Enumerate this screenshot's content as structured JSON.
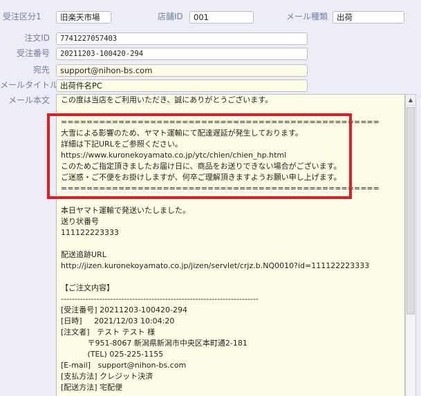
{
  "header": {
    "order_category_label": "受注区分1",
    "order_category_value": "旧楽天市場",
    "shop_id_label": "店舗ID",
    "shop_id_value": "001",
    "mail_type_label": "メール種類",
    "mail_type_value": "出荷"
  },
  "form": {
    "order_id_label": "注文ID",
    "order_id_value": "7741227057403",
    "order_number_label": "受注番号",
    "order_number_value": "20211203-100420-294",
    "recipient_label": "宛先",
    "recipient_value": "support@nihon-bs.com",
    "mail_title_label": "メールタイトル",
    "mail_title_value": "出荷件名PC",
    "mail_body_label": "メール本文"
  },
  "mail_body": {
    "lines": [
      "この度は当店をご利用いただき、誠にありがとうございます。",
      "",
      "==================================================",
      "大雪による影響のため、ヤマト運輸にて配達遅延が発生しております。",
      "詳細は下記URLをご参照ください。",
      "https://www.kuronekoyamato.co.jp/ytc/chien/chien_hp.html",
      "このためご指定頂きましたお届け日に、商品をお送りできない場合がございます。",
      "ご迷惑・ご不便をお掛けしますが、何卒ご理解頂きますようお願い申し上げます。",
      "==================================================",
      "",
      "本日ヤマト運輸で発送いたしました。",
      "送り状番号",
      "111122223333",
      "",
      "配送追跡URL",
      "http://jizen.kuronekoyamato.co.jp/jizen/servlet/crjz.b.NQ0010?id=111122223333",
      "",
      "【ご注文内容】",
      "------------------------------------------------------------------------",
      "[受注番号] 20211203-100420-294",
      "[日時]     2021/12/03 10:04:20",
      "[注文者]   テスト テスト 様",
      "           〒951-8067 新潟県新潟市中央区本町通2-181",
      "           (TEL) 025-225-1155",
      "[E-mail]   support@nihon-bs.com",
      "[支払方法] クレジット決済",
      "[配送方法] 宅配便"
    ]
  },
  "colors": {
    "label": "#6e7fa6",
    "field_bg": "#fffee6",
    "highlight_border": "#e11c24"
  }
}
